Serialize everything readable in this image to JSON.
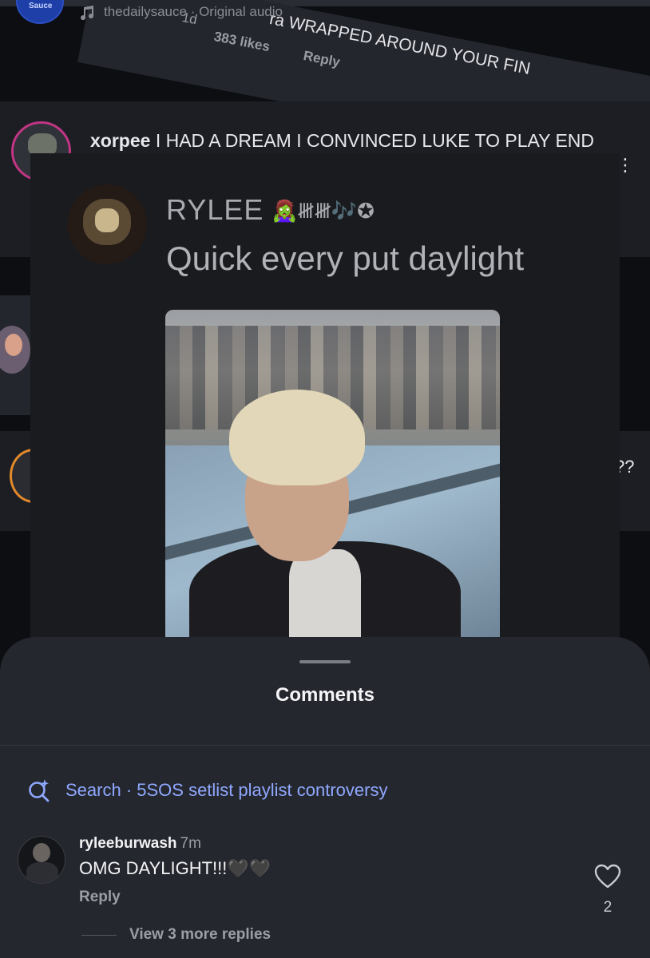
{
  "audio": {
    "account": "thedailysauce",
    "separator": " · ",
    "label": "Original audio",
    "avatar_label": "Sauce"
  },
  "rotated_comment": {
    "time": "1d",
    "likes": "383 likes",
    "reply": "Reply",
    "text": "ra WRAPPED AROUND YOUR FIN"
  },
  "background_comment": {
    "username": "xorpee",
    "text": "I HAD A DREAM I CONVINCED LUKE TO PLAY END",
    "menu": "⋮",
    "trailing": "??"
  },
  "screenshot_post": {
    "name": "RYLEE",
    "emojis": "🧟‍♀️𝍸𝍸🎶✪",
    "text": "Quick every put daylight"
  },
  "comments_sheet": {
    "title": "Comments",
    "search": {
      "label": "Search · 5SOS setlist playlist controversy"
    },
    "comment": {
      "username": "ryleeburwash",
      "time": "7m",
      "text": "OMG DAYLIGHT!!!🖤🖤",
      "reply_label": "Reply",
      "like_count": "2",
      "view_replies": "View 3 more replies"
    }
  },
  "colors": {
    "accent_link": "#8fa8ff",
    "sheet_bg": "#25272e",
    "story_ring": "#c13584"
  },
  "icons": [
    "music-note-icon",
    "search-sparkle-icon",
    "heart-icon",
    "more-options-icon"
  ]
}
